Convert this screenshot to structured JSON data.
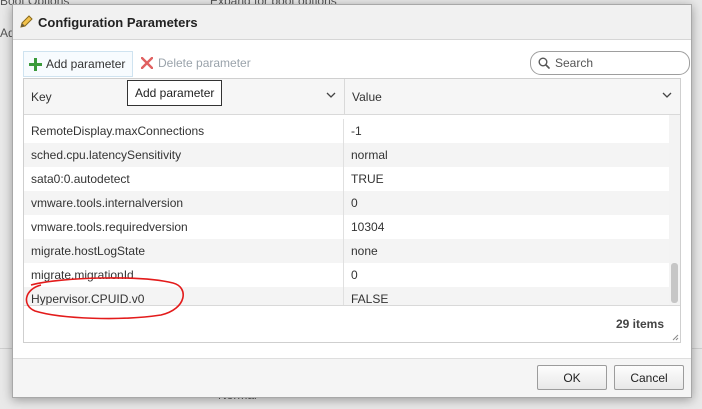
{
  "background": {
    "top_left": "Boot Options",
    "top_middle": "Expand for boot options",
    "left_fragment": "Ad",
    "bottom_fragment": "Normal"
  },
  "dialog": {
    "title": "Configuration Parameters",
    "icon": "pencil-icon"
  },
  "toolbar": {
    "add_label": "Add parameter",
    "delete_label": "Delete parameter",
    "search_placeholder": "Search",
    "search_value": ""
  },
  "tooltip": {
    "text": "Add parameter"
  },
  "grid": {
    "columns": [
      {
        "label": "Key"
      },
      {
        "label": "Value"
      }
    ],
    "rows": [
      {
        "key": "RemoteDisplay.maxConnections",
        "value": "-1"
      },
      {
        "key": "sched.cpu.latencySensitivity",
        "value": "normal"
      },
      {
        "key": "sata0:0.autodetect",
        "value": "TRUE"
      },
      {
        "key": "vmware.tools.internalversion",
        "value": "0"
      },
      {
        "key": "vmware.tools.requiredversion",
        "value": "10304"
      },
      {
        "key": "migrate.hostLogState",
        "value": "none"
      },
      {
        "key": "migrate.migrationId",
        "value": "0"
      },
      {
        "key": "Hypervisor.CPUID.v0",
        "value": "FALSE"
      }
    ],
    "item_count": "29 items"
  },
  "buttons": {
    "ok": "OK",
    "cancel": "Cancel"
  },
  "colors": {
    "add_icon": "#3a9a3a",
    "delete_icon": "#e06060",
    "annotation": "#e31b1b"
  }
}
